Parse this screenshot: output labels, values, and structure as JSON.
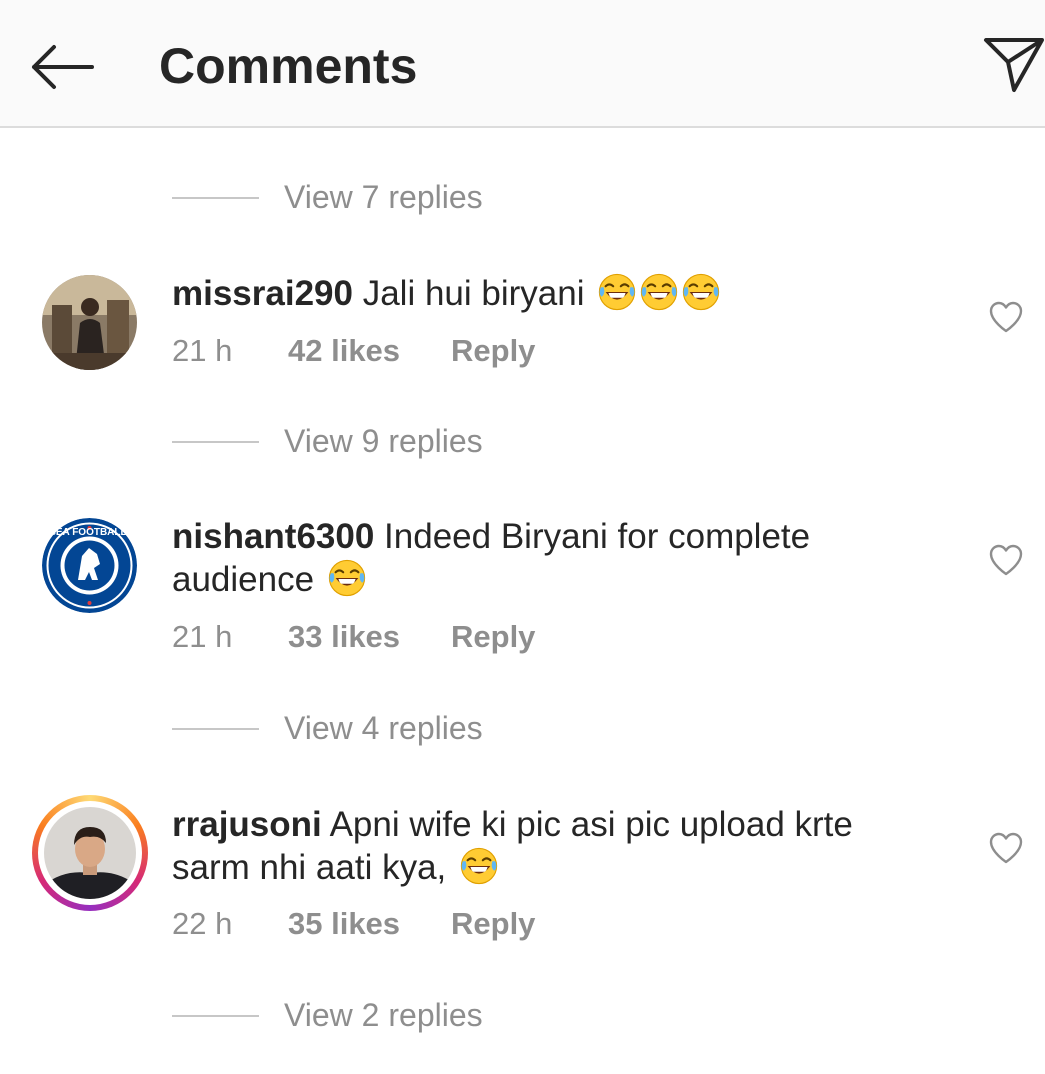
{
  "header": {
    "title": "Comments",
    "back_icon": "arrow-left-icon",
    "send_icon": "paper-plane-icon"
  },
  "top_view_replies": "View 7 replies",
  "comments": [
    {
      "username": "missrai290",
      "text": "Jali hui biryani",
      "emojis": [
        "face-with-tears-of-joy",
        "face-with-tears-of-joy",
        "face-with-tears-of-joy"
      ],
      "time": "21 h",
      "likes": "42 likes",
      "reply": "Reply",
      "view_replies": "View 9 replies"
    },
    {
      "username": "nishant6300",
      "text": "Indeed Biryani for complete audience",
      "emojis": [
        "face-with-tears-of-joy"
      ],
      "avatar_text": "CHELSEA FOOTBALL CLUB",
      "time": "21 h",
      "likes": "33 likes",
      "reply": "Reply",
      "view_replies": "View 4 replies"
    },
    {
      "username": "rrajusoni",
      "text": "Apni wife ki pic asi pic upload krte sarm nhi aati kya,",
      "emojis": [
        "face-with-tears-of-joy"
      ],
      "time": "22 h",
      "likes": "35 likes",
      "reply": "Reply",
      "view_replies": "View 2 replies"
    }
  ],
  "colors": {
    "text_primary": "#262626",
    "text_secondary": "#8e8e8e",
    "header_bg": "#fafafa",
    "divider": "#c7c7c7",
    "chelsea_blue": "#034694"
  }
}
